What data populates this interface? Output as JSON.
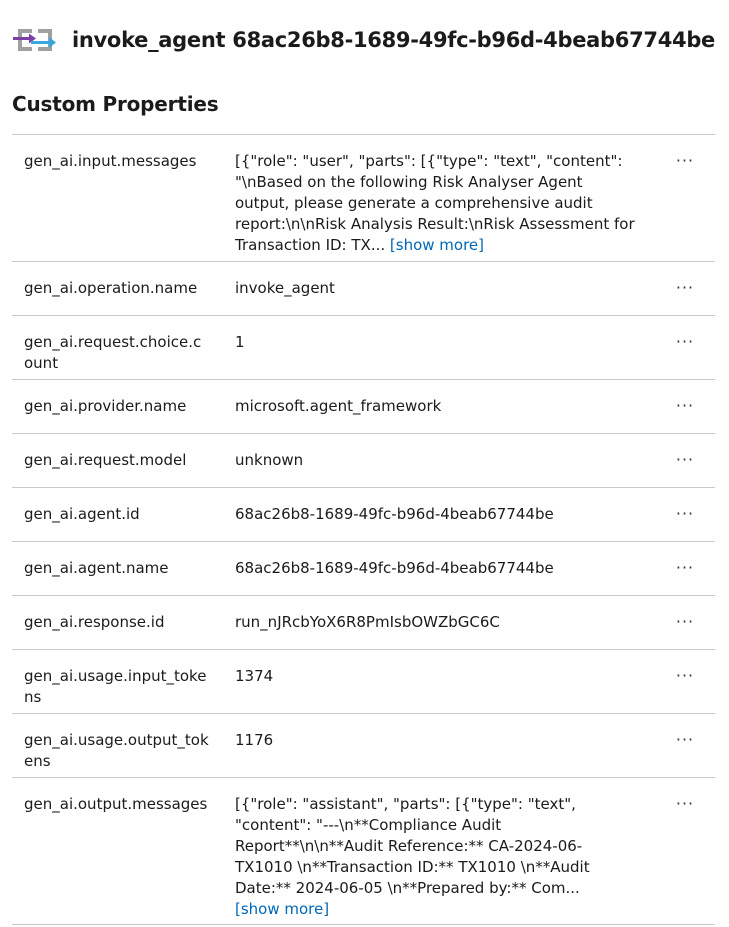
{
  "header": {
    "title": "invoke_agent 68ac26b8-1689-49fc-b96d-4beab67744be",
    "icon": "arrow-exchange-icon"
  },
  "section_title": "Custom Properties",
  "show_more_label": "[show more]",
  "more_label": "···",
  "properties": [
    {
      "key": "gen_ai.input.messages",
      "value": "[{\"role\": \"user\", \"parts\": [{\"type\": \"text\", \"content\": \"\\nBased on the following Risk Analyser Agent output, please generate a comprehensive audit report:\\n\\nRisk Analysis Result:\\nRisk Assessment for Transaction ID: TX...",
      "show_more": true
    },
    {
      "key": "gen_ai.operation.name",
      "value": "invoke_agent"
    },
    {
      "key": "gen_ai.request.choice.count",
      "value": "1"
    },
    {
      "key": "gen_ai.provider.name",
      "value": "microsoft.agent_framework"
    },
    {
      "key": "gen_ai.request.model",
      "value": "unknown"
    },
    {
      "key": "gen_ai.agent.id",
      "value": "68ac26b8-1689-49fc-b96d-4beab67744be"
    },
    {
      "key": "gen_ai.agent.name",
      "value": "68ac26b8-1689-49fc-b96d-4beab67744be"
    },
    {
      "key": "gen_ai.response.id",
      "value": "run_nJRcbYoX6R8PmIsbOWZbGC6C"
    },
    {
      "key": "gen_ai.usage.input_tokens",
      "value": "1374"
    },
    {
      "key": "gen_ai.usage.output_tokens",
      "value": "1176"
    },
    {
      "key": "gen_ai.output.messages",
      "value": "[{\"role\": \"assistant\", \"parts\": [{\"type\": \"text\", \"content\": \"---\\n**Compliance Audit Report**\\n\\n**Audit Reference:** CA-2024-06-TX1010 \\n**Transaction ID:** TX1010 \\n**Audit Date:** 2024-06-05 \\n**Prepared by:** Com...",
      "show_more": true
    }
  ]
}
